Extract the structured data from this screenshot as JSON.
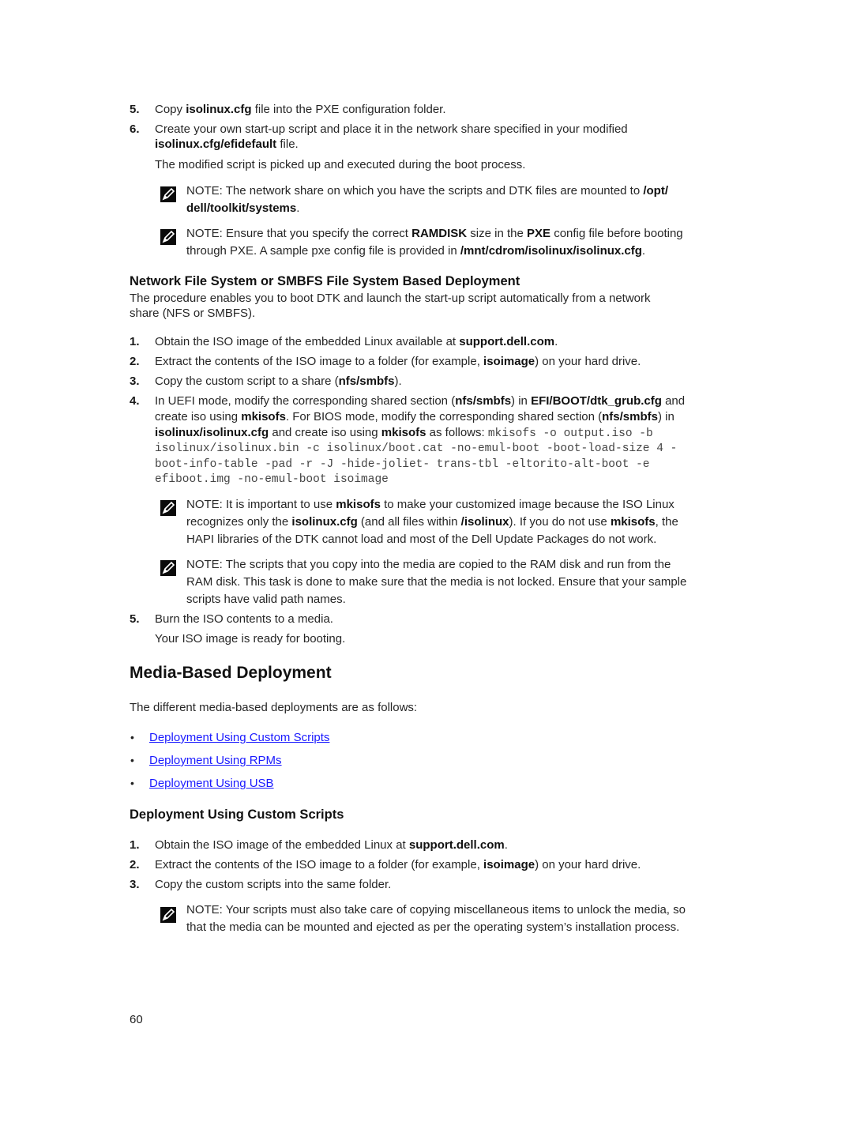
{
  "steps_top": [
    {
      "num": "5.",
      "parts": [
        "Copy ",
        "isolinux.cfg",
        " file into the PXE configuration folder."
      ]
    },
    {
      "num": "6.",
      "line1": "Create your own start-up script and place it in the network share specified in your modified",
      "line2_bold": "isolinux.cfg/efidefault",
      "line2_rest": " file."
    }
  ],
  "step6_followup": "The modified script is picked up and executed during the boot process.",
  "note_label": "NOTE:",
  "notes_top": [
    {
      "t1": " The network share on which you have the scripts and DTK files are mounted to ",
      "b1": "/opt/",
      "b2": "dell/toolkit/systems",
      "t2": "."
    },
    {
      "t1": " Ensure that you specify the correct ",
      "b1": "RAMDISK",
      "t2": " size in the ",
      "b2": "PXE",
      "t3": " config file before booting",
      "t4": "through PXE. A sample pxe config file is provided in ",
      "b3": "/mnt/cdrom/isolinux/isolinux.cfg",
      "t5": "."
    }
  ],
  "nfs_section": {
    "heading": "Network File System or SMBFS File System Based Deployment",
    "intro_line1": "The procedure enables you to boot DTK and launch the start-up script automatically from a network",
    "intro_line2": "share (NFS or SMBFS).",
    "steps": [
      {
        "num": "1.",
        "t1": "Obtain the ISO image of the embedded Linux available at ",
        "b1": "support.dell.com",
        "t2": "."
      },
      {
        "num": "2.",
        "t1": "Extract the contents of the ISO image to a folder (for example, ",
        "b1": "isoimage",
        "t2": ") on your hard drive."
      },
      {
        "num": "3.",
        "t1": "Copy the custom script to a share (",
        "b1": "nfs/smbfs",
        "t2": ")."
      },
      {
        "num": "4.",
        "l1_t1": "In UEFI mode, modify the corresponding shared section (",
        "l1_b1": "nfs/smbfs",
        "l1_t2": ") in ",
        "l1_b2": "EFI/BOOT/dtk_grub.cfg",
        "l1_t3": " and",
        "l2_t1": "create iso using ",
        "l2_b1": "mkisofs",
        "l2_t2": ". For BIOS mode, modify the corresponding shared section (",
        "l2_b2": "nfs/smbfs",
        "l2_t3": ") in",
        "l3_b1": "isolinux/isolinux.cfg",
        "l3_t1": " and create iso using ",
        "l3_b2": "mkisofs",
        "l3_t2": " as follows: ",
        "l3_code": "mkisofs -o output.iso -b",
        "code_l4": "isolinux/isolinux.bin -c isolinux/boot.cat -no-emul-boot -boot-load-size 4 -",
        "code_l5": "boot-info-table -pad -r -J -hide-joliet- trans-tbl -eltorito-alt-boot -e",
        "code_l6": "efiboot.img -no-emul-boot isoimage"
      }
    ],
    "notes": [
      {
        "l1_t1": " It is important to use ",
        "l1_b1": "mkisofs",
        "l1_t2": " to make your customized image because the ISO Linux",
        "l2_t1": "recognizes only the ",
        "l2_b1": "isolinux.cfg",
        "l2_t2": " (and all files within ",
        "l2_b2": "/isolinux",
        "l2_t3": "). If you do not use ",
        "l2_b3": "mkisofs",
        "l2_t4": ", the",
        "l3": "HAPI libraries of the DTK cannot load and most of the Dell Update Packages do not work."
      },
      {
        "l1": " The scripts that you copy into the media are copied to the RAM disk and run from the",
        "l2": "RAM disk. This task is done to make sure that the media is not locked. Ensure that your sample",
        "l3": "scripts have valid path names."
      }
    ],
    "step5": {
      "num": "5.",
      "text": "Burn the ISO contents to a media.",
      "followup": "Your ISO image is ready for booting."
    }
  },
  "media_section": {
    "heading": "Media-Based Deployment",
    "intro": "The different media-based deployments are as follows:",
    "bullet": "•",
    "links": [
      "Deployment Using Custom Scripts",
      "Deployment Using RPMs",
      "Deployment Using USB"
    ],
    "link_color": "#1a1aff"
  },
  "custom_section": {
    "heading": "Deployment Using Custom Scripts",
    "steps": [
      {
        "num": "1.",
        "t1": "Obtain the ISO image of the embedded Linux at ",
        "b1": "support.dell.com",
        "t2": "."
      },
      {
        "num": "2.",
        "t1": "Extract the contents of the ISO image to a folder (for example, ",
        "b1": "isoimage",
        "t2": ") on your hard drive."
      },
      {
        "num": "3.",
        "t1": "Copy the custom scripts into the same folder."
      }
    ],
    "note": {
      "l1": " Your scripts must also take care of copying miscellaneous items to unlock the media, so",
      "l2": "that the media can be mounted and ejected as per the operating system’s installation process."
    }
  },
  "page_number": "60"
}
